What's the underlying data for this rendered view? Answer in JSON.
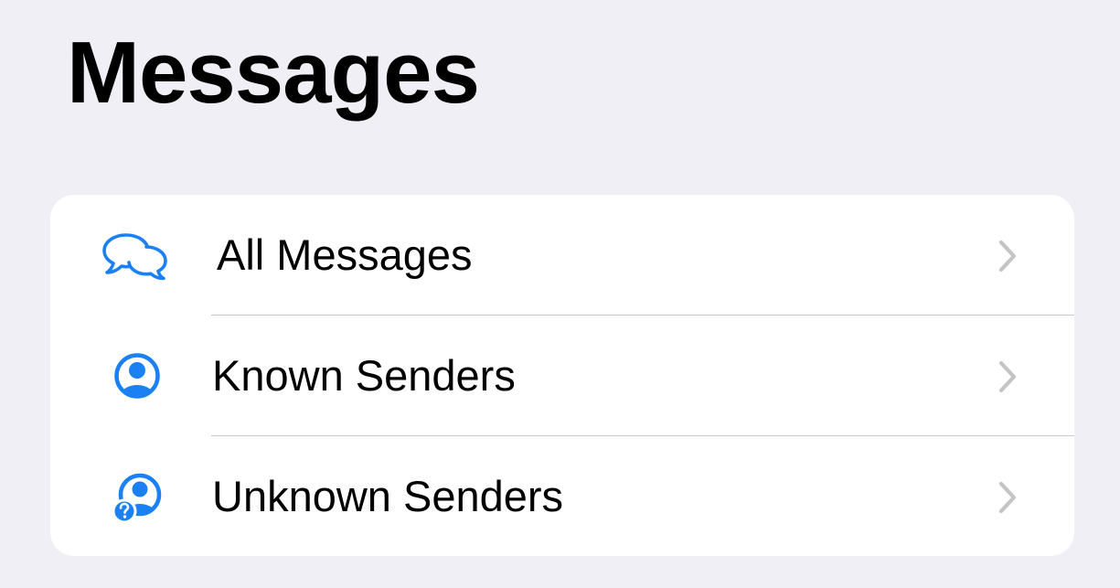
{
  "header": {
    "title": "Messages"
  },
  "accent_color": "#1a80f4",
  "chevron_color": "#c4c4c7",
  "filters": [
    {
      "label": "All Messages",
      "icon": "chat-bubbles-icon"
    },
    {
      "label": "Known Senders",
      "icon": "person-circle-icon"
    },
    {
      "label": "Unknown Senders",
      "icon": "person-question-icon"
    }
  ]
}
